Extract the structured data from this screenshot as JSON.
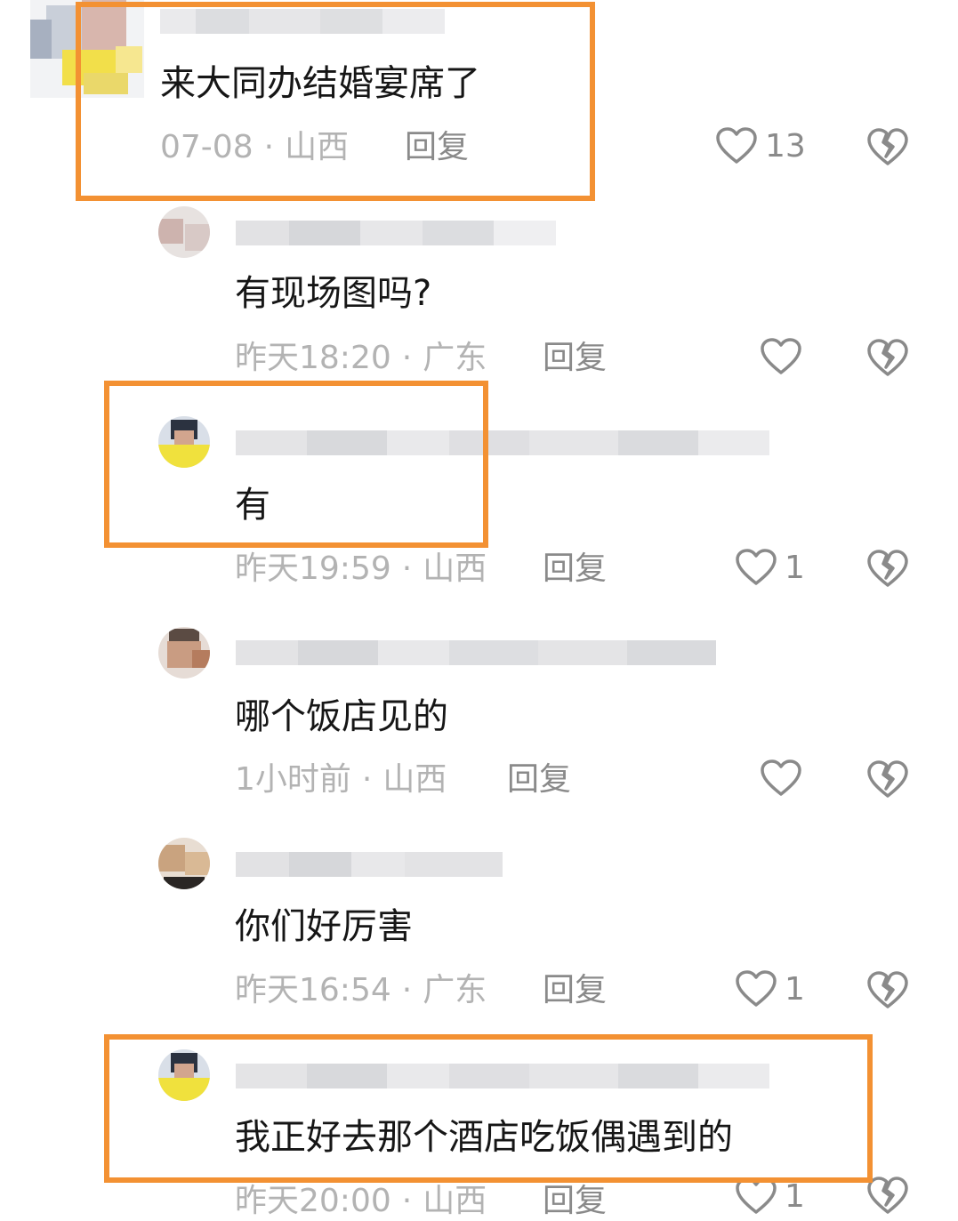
{
  "comments": [
    {
      "text": "来大同办结婚宴席了",
      "time": "07-08",
      "region": "山西",
      "reply": "回复",
      "likes": "13"
    },
    {
      "text": "有现场图吗?",
      "time": "昨天18:20",
      "region": "广东",
      "reply": "回复",
      "likes": ""
    },
    {
      "text": "有",
      "time": "昨天19:59",
      "region": "山西",
      "reply": "回复",
      "likes": "1"
    },
    {
      "text": "哪个饭店见的",
      "time": "1小时前",
      "region": "山西",
      "reply": "回复",
      "likes": ""
    },
    {
      "text": "你们好厉害",
      "time": "昨天16:54",
      "region": "广东",
      "reply": "回复",
      "likes": "1"
    },
    {
      "text": "我正好去那个酒店吃饭偶遇到的",
      "time": "昨天20:00",
      "region": "山西",
      "reply": "回复",
      "likes": "1"
    }
  ],
  "separator": "·",
  "icons": {
    "like": "heart-icon",
    "dislike": "broken-heart-icon"
  },
  "colors": {
    "highlight": "#f39133",
    "text": "#161616",
    "meta": "#b3b3b3"
  }
}
